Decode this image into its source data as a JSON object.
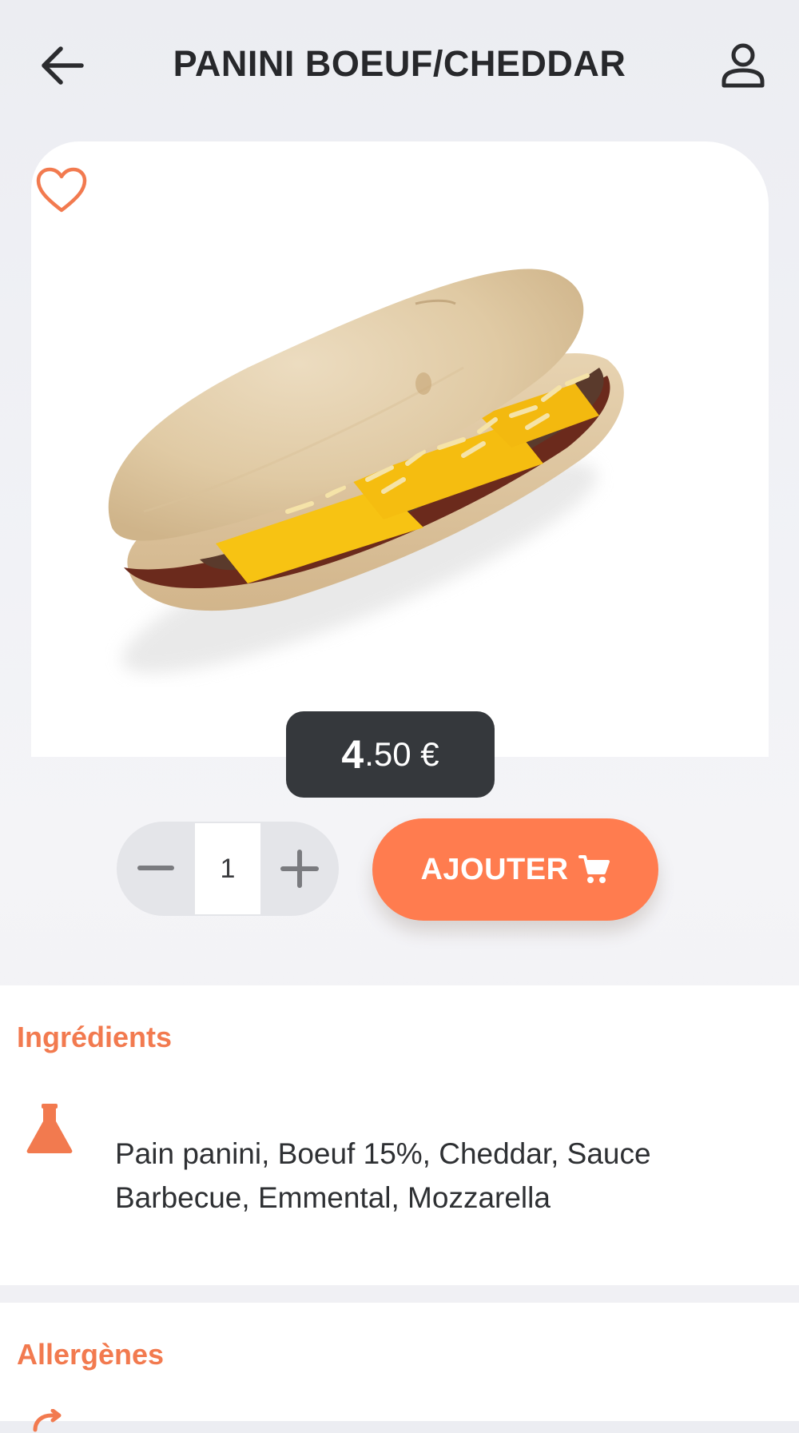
{
  "header": {
    "title": "PANINI BOEUF/CHEDDAR",
    "back_icon": "arrow-left-icon",
    "profile_icon": "user-icon"
  },
  "product": {
    "favorite_icon": "heart-outline-icon",
    "image_description_icon": "panini-photo",
    "price_integer": "4",
    "price_rest": ".50 €"
  },
  "quantity": {
    "minus_icon": "minus-icon",
    "value": "1",
    "plus_icon": "plus-icon"
  },
  "add_button": {
    "label": "AJOUTER",
    "icon": "cart-icon"
  },
  "ingredients": {
    "title": "Ingrédients",
    "icon": "flask-icon",
    "text": "Pain panini, Boeuf 15%, Cheddar, Sauce Barbecue, Emmental, Mozzarella"
  },
  "allergens": {
    "title": "Allergènes",
    "icon": "allergen-icon"
  },
  "colors": {
    "accent": "#ff7c4f",
    "accent_text": "#f27a4f",
    "price_badge": "#35383c",
    "text_dark": "#27282b"
  }
}
